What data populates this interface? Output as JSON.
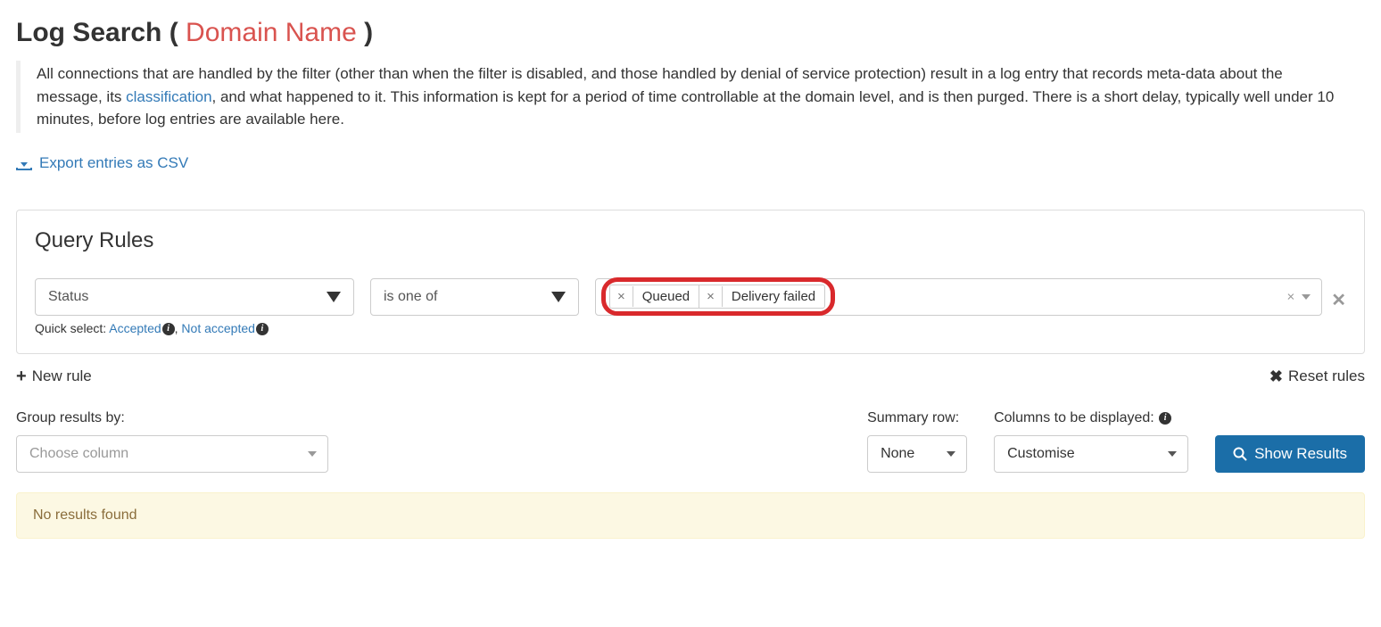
{
  "page_title_prefix": "Log Search",
  "page_title_domain": "Domain Name",
  "intro_part1": "All connections that are handled by the filter (other than when the filter is disabled, and those handled by denial of service protection) result in a log entry that records meta-data about the message, its ",
  "intro_link": "classification",
  "intro_part2": ", and what happened to it. This information is kept for a period of time controllable at the domain level, and is then purged. There is a short delay, typically well under 10 minutes, before log entries are available here.",
  "export_label": "Export entries as CSV",
  "panel_heading": "Query Rules",
  "rule": {
    "field": "Status",
    "operator": "is one of",
    "tags": [
      "Queued",
      "Delivery failed"
    ]
  },
  "quick_select_prefix": "Quick select: ",
  "quick_accepted": "Accepted",
  "quick_not_accepted": "Not accepted",
  "new_rule_label": "New rule",
  "reset_rules_label": "Reset rules",
  "group_by_label": "Group results by:",
  "group_by_placeholder": "Choose column",
  "summary_label": "Summary row:",
  "summary_value": "None",
  "columns_label": "Columns to be displayed:",
  "columns_value": "Customise",
  "show_results_label": "Show Results",
  "no_results": "No results found"
}
